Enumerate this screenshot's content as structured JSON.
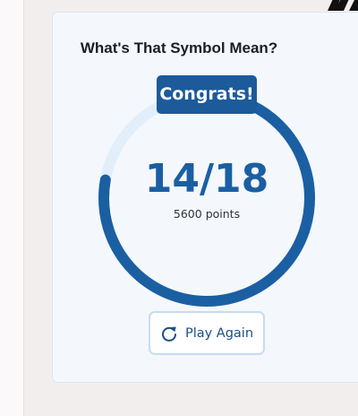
{
  "quiz": {
    "title": "What's That Symbol Mean?",
    "badge_text": "Congrats!",
    "score_text": "14/18",
    "correct": 14,
    "total": 18,
    "points_text": "5600 points",
    "progress_fraction": 0.778
  },
  "actions": {
    "play_again_label": "Play Again",
    "play_again_icon": "refresh-icon"
  },
  "colors": {
    "accent": "#1b5fa3",
    "ring_track": "#e2eefa",
    "badge_bg": "#1c5a9a",
    "card_bg": "#f4f8fc",
    "page_bg": "#f3eeee"
  }
}
